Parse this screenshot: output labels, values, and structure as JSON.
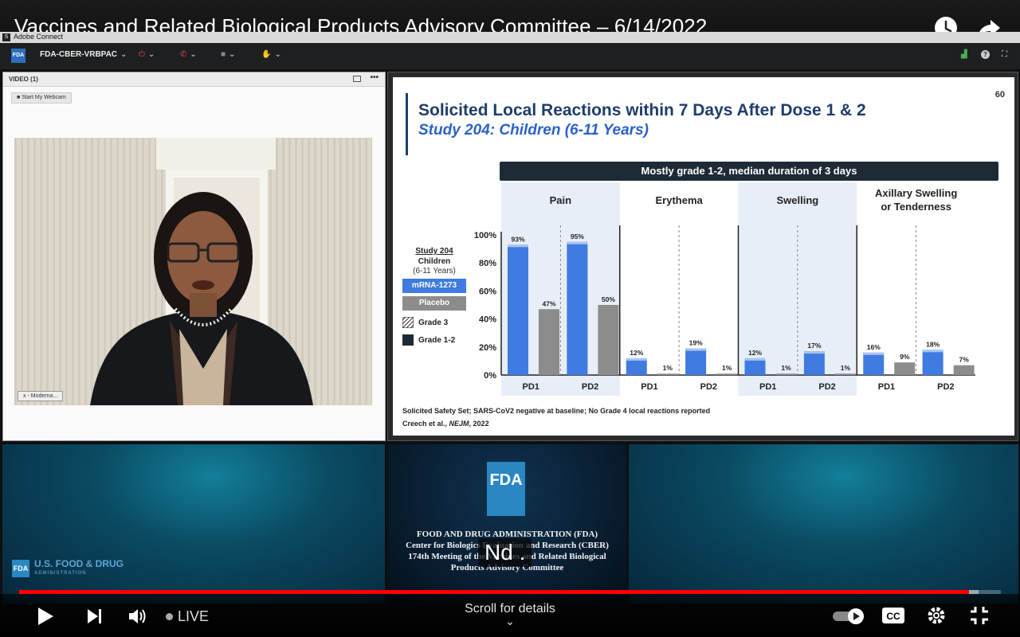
{
  "video_title": "Vaccines and Related Biological Products Advisory Committee – 6/14/2022",
  "app": {
    "window_title": "Adobe Connect",
    "meeting_name": "FDA-CBER-VRBPAC",
    "fda_badge": "FDA"
  },
  "video_pod": {
    "title": "VIDEO (1)",
    "webcam_button": "Start My Webcam",
    "participant_tag": "x - Moderna..."
  },
  "slide": {
    "title": "Solicited Local Reactions within 7 Days After Dose 1 & 2",
    "subtitle": "Study 204: Children (6-11 Years)",
    "page_number": "60",
    "banner": "Mostly grade 1-2, median duration of 3 days",
    "footnote1": "Solicited Safety Set; SARS-CoV2 negative at baseline; No Grade 4 local reactions reported",
    "footnote2_prefix": "Creech et al., ",
    "footnote2_journal": "NEJM",
    "footnote2_suffix": ", 2022",
    "legend": {
      "title": "Study 204",
      "line2": "Children",
      "line3": "(6-11 Years)",
      "mrna": "mRNA-1273",
      "placebo": "Placebo",
      "grade3": "Grade 3",
      "grade12": "Grade 1-2"
    }
  },
  "chart_data": {
    "type": "bar",
    "panels": [
      "Pain",
      "Erythema",
      "Swelling",
      "Axillary Swelling or Tenderness"
    ],
    "doses": [
      "PD1",
      "PD2"
    ],
    "y_ticks": [
      "0%",
      "20%",
      "40%",
      "60%",
      "80%",
      "100%"
    ],
    "ylim": [
      0,
      100
    ],
    "series": [
      {
        "name": "mRNA-1273",
        "color": "#3f7be0",
        "values": [
          93,
          95,
          12,
          19,
          12,
          17,
          16,
          18
        ]
      },
      {
        "name": "Placebo",
        "color": "#8c8c8c",
        "values": [
          47,
          50,
          1,
          1,
          1,
          1,
          9,
          7
        ]
      }
    ],
    "labels_mrna": [
      "93%",
      "95%",
      "12%",
      "19%",
      "12%",
      "17%",
      "16%",
      "18%"
    ],
    "labels_placebo": [
      "47%",
      "50%",
      "1%",
      "1%",
      "1%",
      "1%",
      "9%",
      "7%"
    ]
  },
  "fda_panel": {
    "logo": "FDA",
    "line1": "FOOD AND DRUG ADMINISTRATION (FDA)",
    "line2": "Center for Biologics Evaluation and Research (CBER)",
    "line3": "174th Meeting of the Vaccines and Related Biological",
    "line4": "Products Advisory Committee"
  },
  "usfda": {
    "logo": "FDA",
    "name": "U.S. FOOD & DRUG",
    "sub": "ADMINISTRATION"
  },
  "caption": "Nd .",
  "player": {
    "live_label": "LIVE",
    "scroll_hint": "Scroll for details",
    "progress": 0.9675,
    "buffer_end": 0.977,
    "colors": {
      "progress": "#ff0000",
      "accent": "#1f3d6b"
    }
  }
}
